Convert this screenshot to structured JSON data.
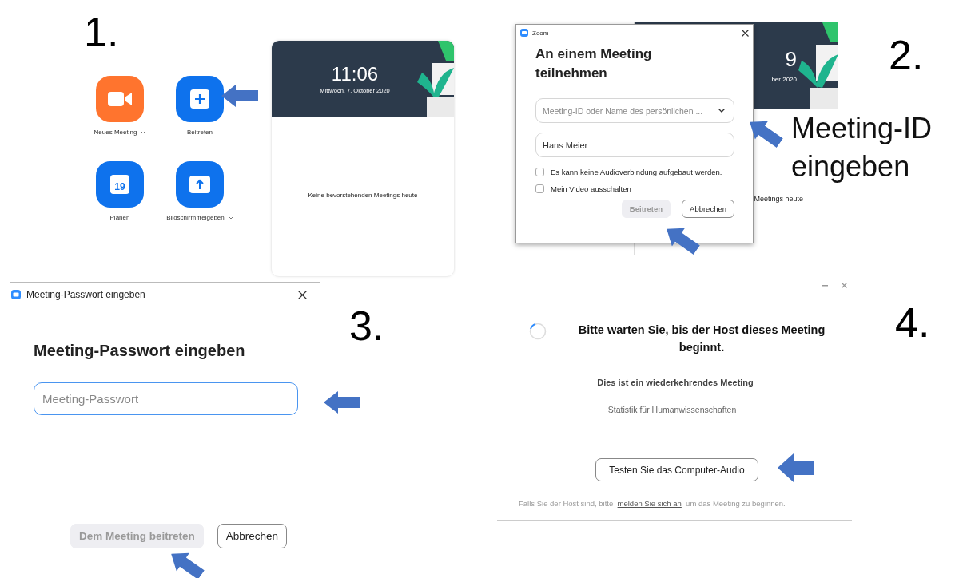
{
  "step_1": {
    "number": "1.",
    "actions": [
      {
        "kind": "video",
        "label": "Neues Meeting",
        "color": "#ff742e",
        "menu": true
      },
      {
        "kind": "plus",
        "label": "Beitreten",
        "color": "#0e72ed",
        "menu": false
      },
      {
        "kind": "calendar",
        "label": "Planen",
        "color": "#0e72ed",
        "menu": false,
        "icon_text": "19"
      },
      {
        "kind": "share",
        "label": "Bildschirm freigeben",
        "color": "#0e72ed",
        "menu": true
      }
    ],
    "card": {
      "time": "11:06",
      "date": "Mittwoch, 7. Oktober 2020",
      "empty_text": "Keine bevorstehenden Meetings heute"
    }
  },
  "step_2": {
    "number": "2.",
    "caption": [
      "Meeting-ID",
      "eingeben"
    ],
    "background_card": {
      "time_fragment": "9",
      "date_fragment": "ber 2020",
      "text_fragment": "Meetings heute"
    },
    "dialog": {
      "title": "Zoom",
      "heading": "An einem Meeting teilnehmen",
      "meeting_id": {
        "placeholder": "Meeting-ID oder Name des persönlichen ..."
      },
      "name": {
        "value": "Hans Meier"
      },
      "options": [
        {
          "label": "Es kann keine Audioverbindung aufgebaut werden.",
          "checked": false
        },
        {
          "label": "Mein Video ausschalten",
          "checked": false
        }
      ],
      "buttons": [
        {
          "label": "Beitreten",
          "disabled": true
        },
        {
          "label": "Abbrechen",
          "disabled": false
        }
      ]
    }
  },
  "step_3": {
    "number": "3.",
    "window_title": "Meeting-Passwort eingeben",
    "heading": "Meeting-Passwort eingeben",
    "password": {
      "placeholder": "Meeting-Passwort"
    },
    "buttons": [
      {
        "label": "Dem Meeting beitreten",
        "disabled": true
      },
      {
        "label": "Abbrechen",
        "disabled": false
      }
    ]
  },
  "step_4": {
    "number": "4.",
    "heading": "Bitte warten Sie, bis der Host dieses Meeting beginnt.",
    "subheading": "Dies ist ein wiederkehrendes Meeting",
    "topic": "Statistik für Humanwissenschaften",
    "button": "Testen Sie das Computer-Audio",
    "footer": {
      "before": "Falls Sie der Host sind, bitte",
      "link": "melden Sie sich an",
      "after": "um das Meeting zu beginnen."
    }
  }
}
